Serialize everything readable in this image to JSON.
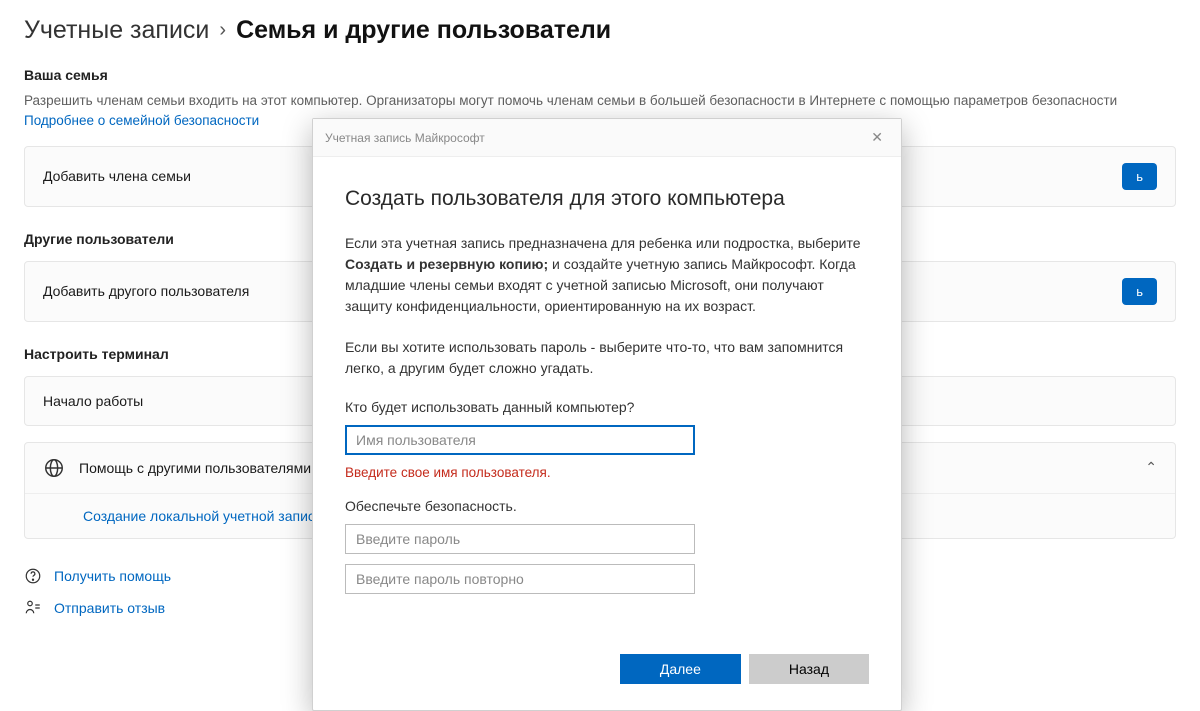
{
  "breadcrumb": {
    "parent": "Учетные записи",
    "current": "Семья и другие пользователи"
  },
  "family": {
    "title": "Ваша семья",
    "desc": "Разрешить членам семьи входить на этот компьютер. Организаторы могут помочь членам семьи в большей безопасности в Интернете с помощью параметров безопасности",
    "link": "Подробнее о семейной безопасности",
    "tile_label": "Добавить члена семьи",
    "tile_button": "ь"
  },
  "others": {
    "title": "Другие пользователи",
    "tile_label": "Добавить другого пользователя",
    "tile_button": "ь"
  },
  "terminal": {
    "title": "Настроить терминал",
    "tile_label": "Начало работы"
  },
  "related": {
    "header": "Помощь с другими пользователями",
    "sub_link": "Создание локальной учетной записи п"
  },
  "footer": {
    "help": "Получить помощь",
    "feedback": "Отправить отзыв"
  },
  "modal": {
    "titlebar": "Учетная запись Майкрософт",
    "heading": "Создать пользователя для этого компьютера",
    "para1_prefix": "Если эта учетная запись предназначена для ребенка или подростка, выберите ",
    "para1_bold": "Создать и резервную копию;",
    "para1_suffix": " и создайте учетную запись Майкрософт. Когда младшие члены семьи входят с учетной записью Microsoft, они получают защиту конфиденциальности, ориентированную на их возраст.",
    "para2": "Если вы хотите использовать пароль - выберите что-то, что вам запомнится легко, а другим будет сложно угадать.",
    "who_label": "Кто будет использовать данный компьютер?",
    "username_placeholder": "Имя пользователя",
    "error": "Введите свое имя пользователя.",
    "security_label": "Обеспечьте безопасность.",
    "password_placeholder": "Введите пароль",
    "password2_placeholder": "Введите пароль повторно",
    "next": "Далее",
    "back": "Назад"
  }
}
